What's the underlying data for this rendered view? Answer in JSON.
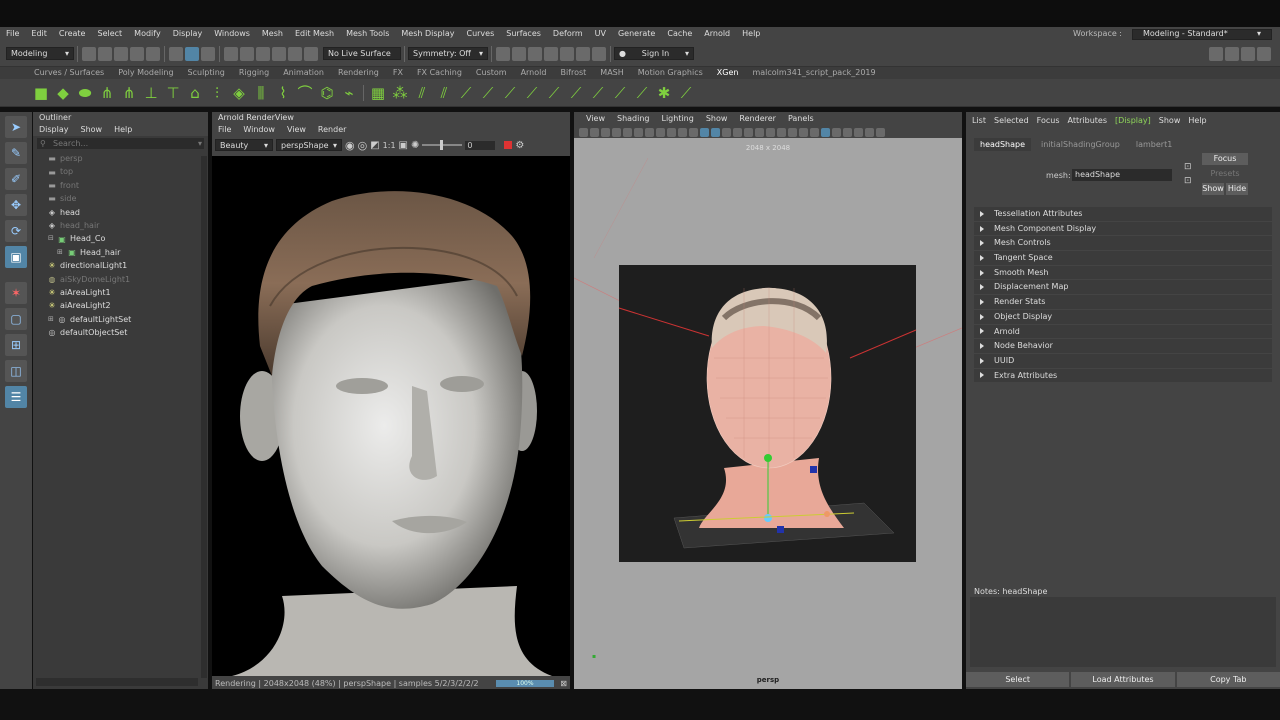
{
  "menubar": {
    "items": [
      "File",
      "Edit",
      "Create",
      "Select",
      "Modify",
      "Display",
      "Windows",
      "Mesh",
      "Edit Mesh",
      "Mesh Tools",
      "Mesh Display",
      "Curves",
      "Surfaces",
      "Deform",
      "UV",
      "Generate",
      "Cache",
      "Arnold",
      "Help"
    ],
    "workspace_label": "Workspace :",
    "workspace_value": "Modeling - Standard*"
  },
  "statusline": {
    "mode": "Modeling",
    "live_surface": "No Live Surface",
    "symmetry": "Symmetry: Off",
    "sign_in": "Sign In"
  },
  "shelf": {
    "tabs": [
      "Curves / Surfaces",
      "Poly Modeling",
      "Sculpting",
      "Rigging",
      "Animation",
      "Rendering",
      "FX",
      "FX Caching",
      "Custom",
      "Arnold",
      "Bifrost",
      "MASH",
      "Motion Graphics",
      "XGen",
      "malcolm341_script_pack_2019"
    ],
    "active_tab": "XGen"
  },
  "outliner": {
    "title": "Outliner",
    "menu": [
      "Display",
      "Show",
      "Help"
    ],
    "search_placeholder": "Search...",
    "items": [
      {
        "label": "persp",
        "icon": "camera-icon",
        "dim": true,
        "indent": 0
      },
      {
        "label": "top",
        "icon": "camera-icon",
        "dim": true,
        "indent": 0
      },
      {
        "label": "front",
        "icon": "camera-icon",
        "dim": true,
        "indent": 0
      },
      {
        "label": "side",
        "icon": "camera-icon",
        "dim": true,
        "indent": 0
      },
      {
        "label": "head",
        "icon": "mesh-icon",
        "dim": false,
        "indent": 0
      },
      {
        "label": "head_hair",
        "icon": "mesh-icon",
        "dim": true,
        "indent": 0
      },
      {
        "label": "Head_Co",
        "icon": "group-icon",
        "dim": false,
        "indent": 0,
        "expand": "minus"
      },
      {
        "label": "Head_hair",
        "icon": "group-icon",
        "dim": false,
        "indent": 1,
        "expand": "plus"
      },
      {
        "label": "directionalLight1",
        "icon": "light-icon",
        "dim": false,
        "indent": 0
      },
      {
        "label": "aiSkyDomeLight1",
        "icon": "skydome-icon",
        "dim": true,
        "indent": 0
      },
      {
        "label": "aiAreaLight1",
        "icon": "light-icon",
        "dim": false,
        "indent": 0
      },
      {
        "label": "aiAreaLight2",
        "icon": "light-icon",
        "dim": false,
        "indent": 0
      },
      {
        "label": "defaultLightSet",
        "icon": "set-icon",
        "dim": false,
        "indent": 0,
        "expand": "plus"
      },
      {
        "label": "defaultObjectSet",
        "icon": "set-icon",
        "dim": false,
        "indent": 0
      }
    ]
  },
  "renderview": {
    "title": "Arnold RenderView",
    "menu": [
      "File",
      "Window",
      "View",
      "Render"
    ],
    "aov": "Beauty",
    "camera": "perspShape",
    "ratio": "1:1",
    "exposure": "0",
    "status": "Rendering | 2048x2048 (48%) | perspShape | samples 5/2/3/2/2/2",
    "progress_label": "100%"
  },
  "viewport": {
    "menu": [
      "View",
      "Shading",
      "Lighting",
      "Show",
      "Renderer",
      "Panels"
    ],
    "resolution": "2048 x 2048",
    "camera_label": "persp"
  },
  "attribute_editor": {
    "menu": [
      "List",
      "Selected",
      "Focus",
      "Attributes",
      "Display",
      "Show",
      "Help"
    ],
    "menu_active": "Display",
    "tabs": [
      "headShape",
      "initialShadingGroup",
      "lambert1"
    ],
    "active_tab": "headShape",
    "mesh_label": "mesh:",
    "mesh_value": "headShape",
    "focus": "Focus",
    "presets": "Presets",
    "show": "Show",
    "hide": "Hide",
    "sections": [
      "Tessellation Attributes",
      "Mesh Component Display",
      "Mesh Controls",
      "Tangent Space",
      "Smooth Mesh",
      "Displacement Map",
      "Render Stats",
      "Object Display",
      "Arnold",
      "Node Behavior",
      "UUID",
      "Extra Attributes"
    ],
    "notes_label": "Notes:",
    "notes_value": "headShape",
    "buttons": [
      "Select",
      "Load Attributes",
      "Copy Tab"
    ]
  },
  "colors": {
    "accent": "#5285a6",
    "green": "#7fcf3f",
    "active_tab": "#2b2b2b"
  }
}
